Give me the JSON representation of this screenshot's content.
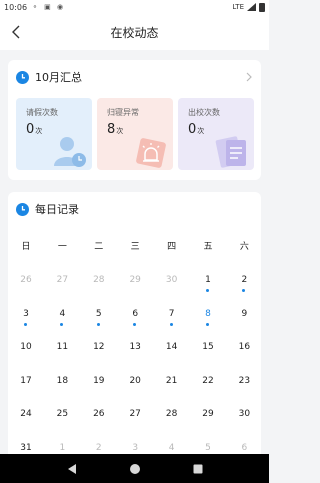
{
  "status_bar": {
    "time": "10:06",
    "network": "LTE"
  },
  "header": {
    "title": "在校动态"
  },
  "summary": {
    "title": "10月汇总",
    "stats": [
      {
        "label": "请假次数",
        "value": "0",
        "unit": "次",
        "icon": "person-clock-icon"
      },
      {
        "label": "归寝异常",
        "value": "8",
        "unit": "次",
        "icon": "alarm-light-icon"
      },
      {
        "label": "出校次数",
        "value": "0",
        "unit": "次",
        "icon": "document-icon"
      }
    ]
  },
  "daily": {
    "title": "每日记录",
    "weekdays": [
      "日",
      "一",
      "二",
      "三",
      "四",
      "五",
      "六"
    ],
    "weeks": [
      [
        {
          "d": "26",
          "m": true
        },
        {
          "d": "27",
          "m": true
        },
        {
          "d": "28",
          "m": true
        },
        {
          "d": "29",
          "m": true
        },
        {
          "d": "30",
          "m": true
        },
        {
          "d": "1",
          "dot": true
        },
        {
          "d": "2",
          "dot": true
        }
      ],
      [
        {
          "d": "3",
          "dot": true
        },
        {
          "d": "4",
          "dot": true
        },
        {
          "d": "5",
          "dot": true
        },
        {
          "d": "6",
          "dot": true
        },
        {
          "d": "7",
          "dot": true
        },
        {
          "d": "8",
          "dot": true,
          "blue": true
        },
        {
          "d": "9"
        }
      ],
      [
        {
          "d": "10"
        },
        {
          "d": "11"
        },
        {
          "d": "12"
        },
        {
          "d": "13"
        },
        {
          "d": "14"
        },
        {
          "d": "15"
        },
        {
          "d": "16"
        }
      ],
      [
        {
          "d": "17"
        },
        {
          "d": "18"
        },
        {
          "d": "19"
        },
        {
          "d": "20"
        },
        {
          "d": "21"
        },
        {
          "d": "22"
        },
        {
          "d": "23"
        }
      ],
      [
        {
          "d": "24"
        },
        {
          "d": "25"
        },
        {
          "d": "26"
        },
        {
          "d": "27"
        },
        {
          "d": "28"
        },
        {
          "d": "29"
        },
        {
          "d": "30"
        }
      ],
      [
        {
          "d": "31"
        },
        {
          "d": "1",
          "m": true
        },
        {
          "d": "2",
          "m": true
        },
        {
          "d": "3",
          "m": true
        },
        {
          "d": "4",
          "m": true
        },
        {
          "d": "5",
          "m": true
        },
        {
          "d": "6",
          "m": true
        }
      ]
    ]
  },
  "colors": {
    "accent": "#1b86e3",
    "leave_bg": "#e3effb",
    "abnormal_bg": "#fbe9e6",
    "exit_bg": "#ece9f8"
  }
}
